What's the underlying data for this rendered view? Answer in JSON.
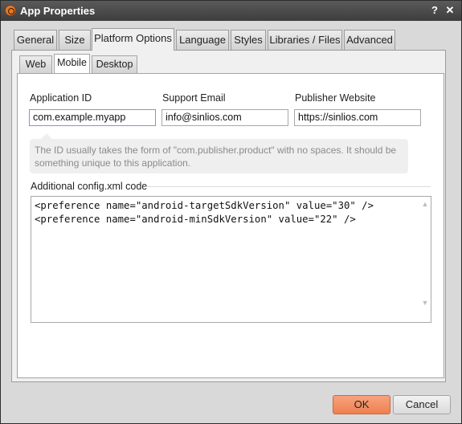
{
  "window": {
    "title": "App Properties",
    "help_glyph": "?",
    "close_glyph": "✕"
  },
  "tabs": [
    {
      "label": "General"
    },
    {
      "label": "Size"
    },
    {
      "label": "Platform Options",
      "active": true
    },
    {
      "label": "Language"
    },
    {
      "label": "Styles"
    },
    {
      "label": "Libraries / Files"
    },
    {
      "label": "Advanced"
    }
  ],
  "subtabs": [
    {
      "label": "Web"
    },
    {
      "label": "Mobile",
      "active": true
    },
    {
      "label": "Desktop"
    }
  ],
  "form": {
    "app_id_label": "Application ID",
    "app_id_value": "com.example.myapp",
    "support_email_label": "Support Email",
    "support_email_value": "info@sinlios.com",
    "publisher_website_label": "Publisher Website",
    "publisher_website_value": "https://sinlios.com",
    "hint_text": "The ID usually takes the form of \"com.publisher.product\" with no spaces. It should be something unique to this application.",
    "config_label": "Additional config.xml code",
    "config_code": "<preference name=\"android-targetSdkVersion\" value=\"30\" />\n<preference name=\"android-minSdkVersion\" value=\"22\" />"
  },
  "buttons": {
    "ok": "OK",
    "cancel": "Cancel"
  },
  "colors": {
    "accent_ok": "#ef7f50",
    "titlebar": "#3d3d3d"
  }
}
